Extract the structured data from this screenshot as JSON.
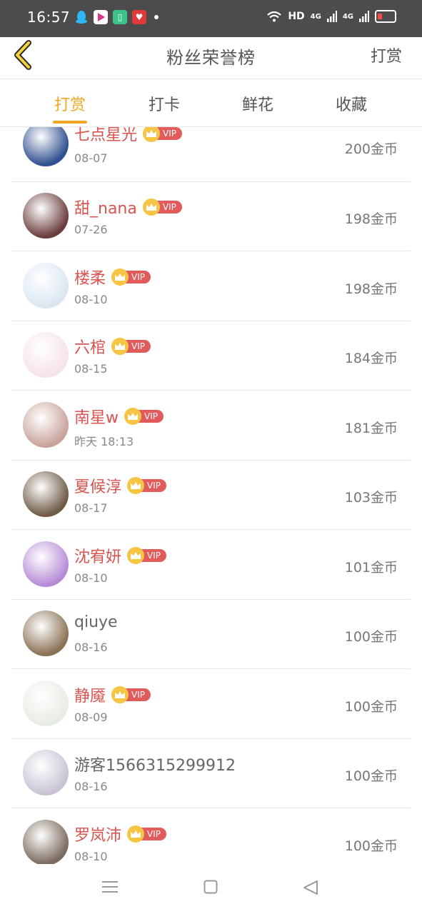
{
  "status": {
    "time": "16:57",
    "network": "HD",
    "signal_1": "4G",
    "signal_2": "4G"
  },
  "header": {
    "title": "粉丝荣誉榜",
    "action": "打赏"
  },
  "tabs": [
    "打赏",
    "打卡",
    "鲜花",
    "收藏"
  ],
  "active_tab": 0,
  "vip_label": "VIP",
  "fans": [
    {
      "name": "七点星光",
      "date": "08-07",
      "coins": "200金币",
      "vip": true,
      "avatar_color": "#2f4f8f"
    },
    {
      "name": "甜_nana",
      "date": "07-26",
      "coins": "198金币",
      "vip": true,
      "avatar_color": "#6b3c3c"
    },
    {
      "name": "楼柔",
      "date": "08-10",
      "coins": "198金币",
      "vip": true,
      "avatar_color": "#dbe6f2"
    },
    {
      "name": "六棺",
      "date": "08-15",
      "coins": "184金币",
      "vip": true,
      "avatar_color": "#f6e3ea"
    },
    {
      "name": "南星w",
      "date": "昨天 18:13",
      "coins": "181金币",
      "vip": true,
      "avatar_color": "#c9a39b"
    },
    {
      "name": "夏候淳",
      "date": "08-17",
      "coins": "103金币",
      "vip": true,
      "avatar_color": "#6e5a46"
    },
    {
      "name": "沈宥妍",
      "date": "08-10",
      "coins": "101金币",
      "vip": true,
      "avatar_color": "#b68bd6"
    },
    {
      "name": "qiuye",
      "date": "08-16",
      "coins": "100金币",
      "vip": false,
      "avatar_color": "#8a7155"
    },
    {
      "name": "静魇",
      "date": "08-09",
      "coins": "100金币",
      "vip": true,
      "avatar_color": "#e7ece3"
    },
    {
      "name": "游客1566315299912",
      "date": "08-16",
      "coins": "100金币",
      "vip": false,
      "avatar_color": "#c9c3d4"
    },
    {
      "name": "罗岚沛",
      "date": "08-10",
      "coins": "100金币",
      "vip": true,
      "avatar_color": "#7b6a5e"
    }
  ],
  "colors": {
    "accent": "#f5a623",
    "name_red": "#d9534f",
    "vip_red": "#e25b5b",
    "crown_gold": "#f7c544"
  },
  "icons": [
    "back-chevron-icon",
    "menu-icon",
    "home-square-icon",
    "back-triangle-icon"
  ]
}
